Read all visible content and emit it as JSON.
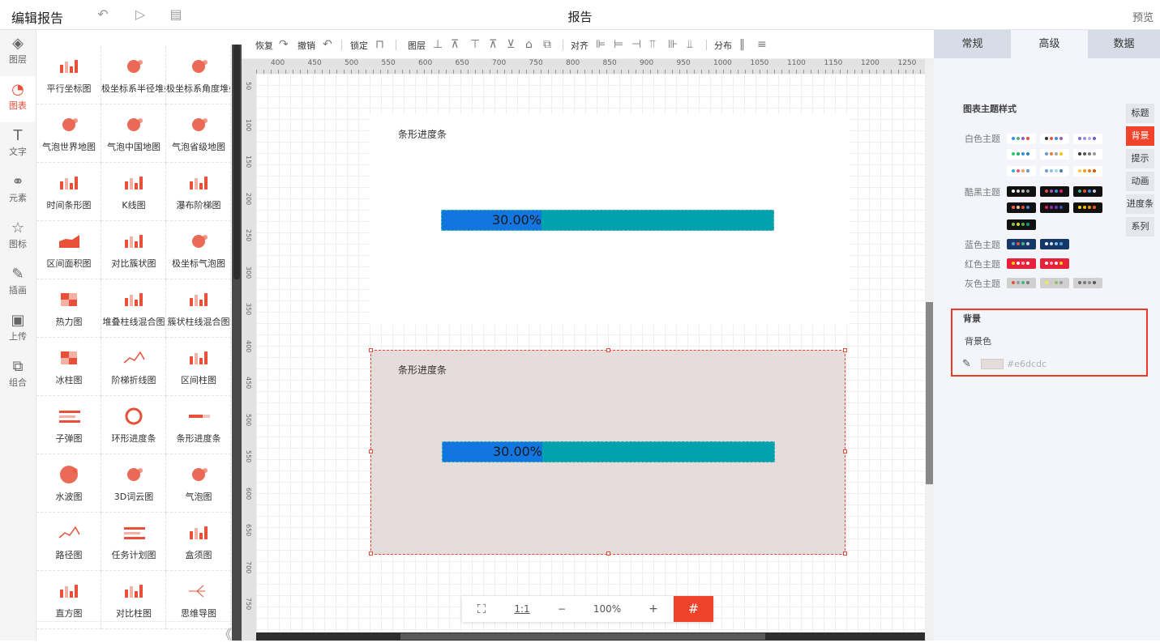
{
  "topbar": {
    "title": "编辑报告",
    "center_title": "报告",
    "preview": "预览",
    "undo_icon": "undo-icon",
    "play_icon": "play-icon",
    "save_icon": "save-icon"
  },
  "leftnav": [
    {
      "label": "图层",
      "icon": "layers-icon",
      "glyph": "◈"
    },
    {
      "label": "图表",
      "icon": "chart-pie-icon",
      "glyph": "◔",
      "active": true
    },
    {
      "label": "文字",
      "icon": "text-icon",
      "glyph": "T"
    },
    {
      "label": "元素",
      "icon": "elements-icon",
      "glyph": "⚭"
    },
    {
      "label": "图标",
      "icon": "star-icon",
      "glyph": "☆"
    },
    {
      "label": "插画",
      "icon": "palette-icon",
      "glyph": "✎"
    },
    {
      "label": "上传",
      "icon": "upload-image-icon",
      "glyph": "▣"
    },
    {
      "label": "组合",
      "icon": "group-icon",
      "glyph": "⧉"
    }
  ],
  "palette": [
    "平行坐标图",
    "极坐标系半径堆叠",
    "极坐标系角度堆叠",
    "气泡世界地图",
    "气泡中国地图",
    "气泡省级地图",
    "时间条形图",
    "K线图",
    "瀑布阶梯图",
    "区间面积图",
    "对比簇状图",
    "极坐标气泡图",
    "热力图",
    "堆叠柱线混合图",
    "簇状柱线混合图",
    "冰柱图",
    "阶梯折线图",
    "区间柱图",
    "子弹图",
    "环形进度条",
    "条形进度条",
    "水波图",
    "3D词云图",
    "气泡图",
    "路径图",
    "任务计划图",
    "盒须图",
    "直方图",
    "对比柱图",
    "思维导图"
  ],
  "collapse_glyph": "《",
  "toolbar": {
    "redo": "恢复",
    "undo": "撤销",
    "lock": "锁定",
    "layer": "图层",
    "align": "对齐",
    "distribute": "分布"
  },
  "ruler": {
    "h": [
      "400",
      "450",
      "500",
      "550",
      "600",
      "650",
      "700",
      "750",
      "800",
      "850",
      "900",
      "950",
      "1000",
      "1050",
      "1100",
      "1150",
      "1200",
      "1250"
    ],
    "v": [
      "50",
      "100",
      "150",
      "200",
      "250",
      "300",
      "350",
      "400",
      "450",
      "500",
      "550",
      "600",
      "650",
      "700",
      "750"
    ]
  },
  "cards": [
    {
      "title": "条形进度条",
      "progress": 0.3,
      "label": "30.00%"
    },
    {
      "title": "条形进度条",
      "progress": 0.3,
      "label": "30.00%",
      "background": "#e6dcdc"
    }
  ],
  "zoom": {
    "fit_icon": "fit-screen-icon",
    "ratio": "1:1",
    "minus": "−",
    "value": "100%",
    "plus": "+",
    "grid_icon": "grid-icon"
  },
  "rpanel": {
    "tabs": [
      "常规",
      "高级",
      "数据"
    ],
    "active_tab": 1,
    "section": "图表主题样式",
    "themes": [
      {
        "label": "白色主题"
      },
      {
        "label": "酷黑主题"
      },
      {
        "label": "蓝色主题"
      },
      {
        "label": "红色主题"
      },
      {
        "label": "灰色主题"
      }
    ],
    "sidetabs": [
      "标题",
      "背景",
      "提示",
      "动画",
      "进度条",
      "系列"
    ],
    "active_sidetab": 1,
    "bg_section": "背景",
    "bg_label": "背景色",
    "bg_value": "#e6dcdc",
    "dropper_icon": "eyedropper-icon"
  },
  "colors": {
    "accent": "#f0432b",
    "bar_track": "#00a2ae",
    "bar_fill": "#1176e0"
  }
}
